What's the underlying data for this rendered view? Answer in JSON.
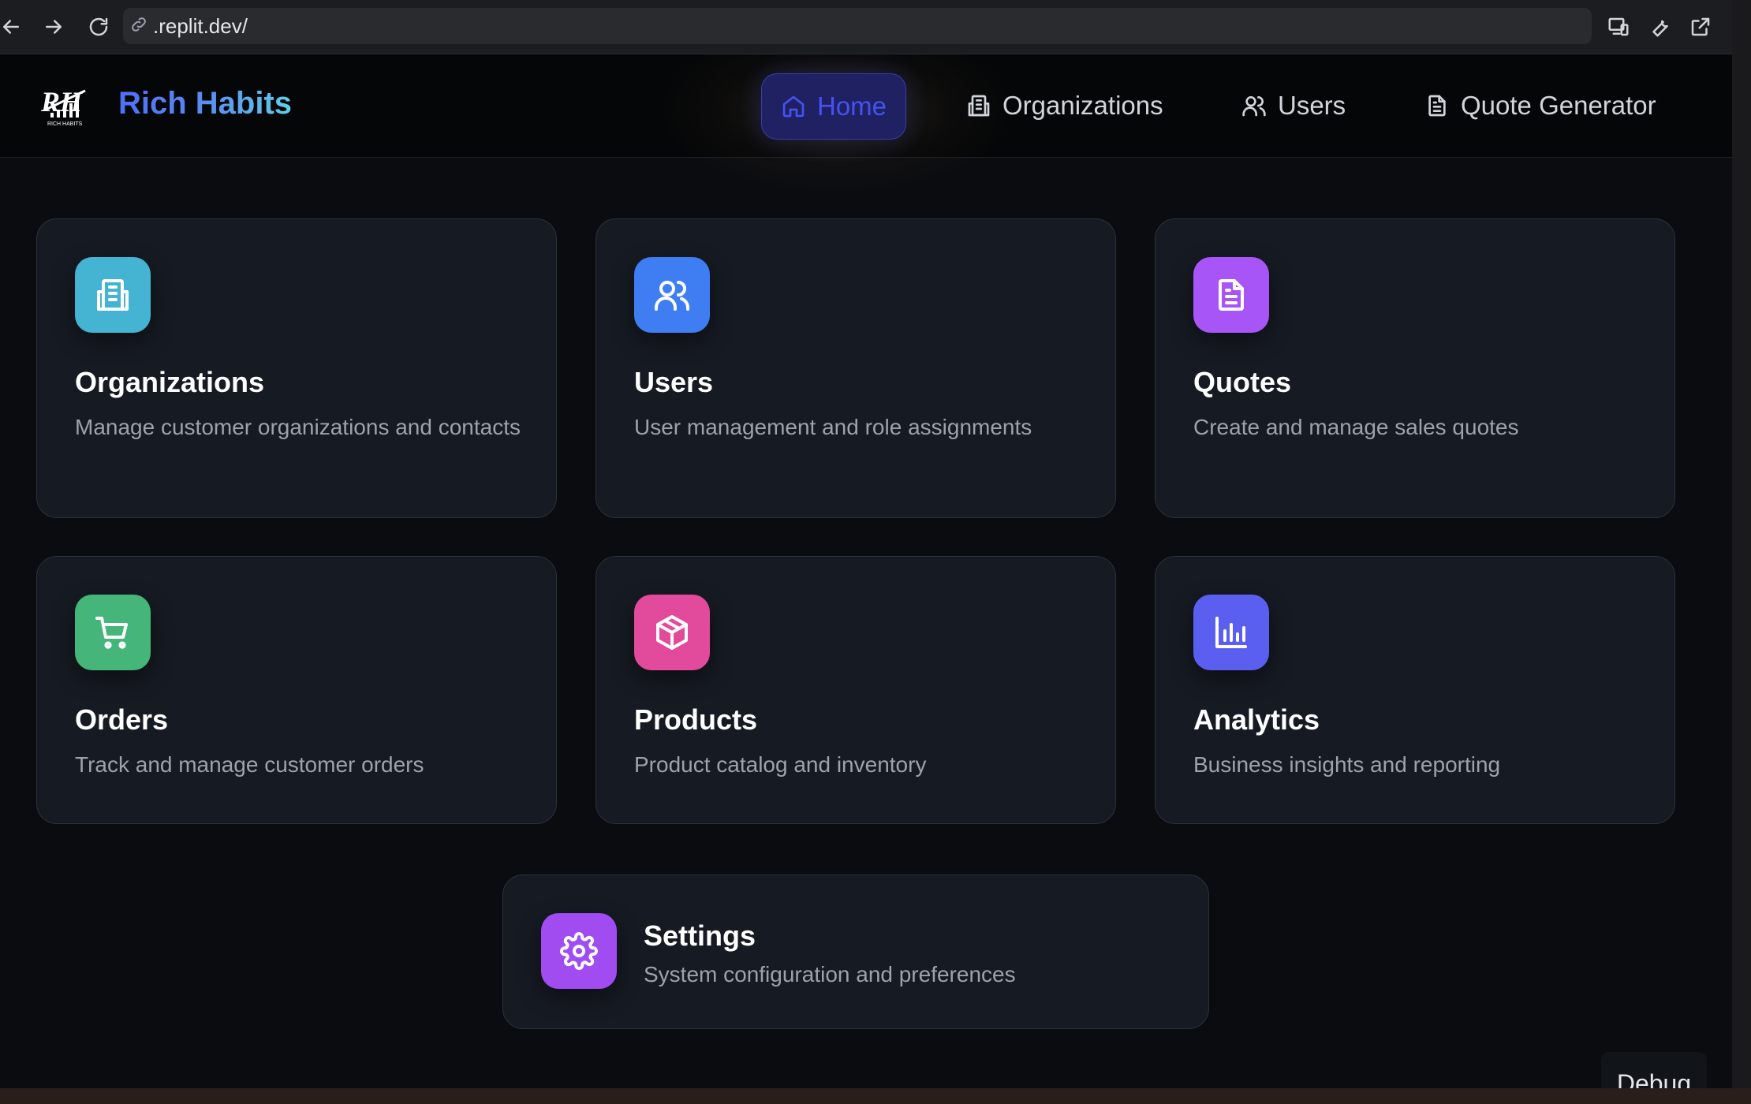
{
  "browser": {
    "url": ".replit.dev/",
    "icons": [
      "back-icon",
      "forward-icon",
      "reload-icon",
      "link-icon",
      "devices-icon",
      "wrench-icon",
      "external-link-icon"
    ]
  },
  "app": {
    "brand": "Rich Habits",
    "nav": [
      {
        "label": "Home",
        "icon": "home-icon",
        "active": true
      },
      {
        "label": "Organizations",
        "icon": "building-icon",
        "active": false
      },
      {
        "label": "Users",
        "icon": "users-icon",
        "active": false
      },
      {
        "label": "Quote Generator",
        "icon": "file-text-icon",
        "active": false
      }
    ],
    "cards": [
      {
        "title": "Organizations",
        "desc": "Manage customer organizations and contacts",
        "icon": "building-icon",
        "color": "#45b3d2"
      },
      {
        "title": "Users",
        "desc": "User management and role assignments",
        "icon": "users-icon",
        "color": "#3f7ef2"
      },
      {
        "title": "Quotes",
        "desc": "Create and manage sales quotes",
        "icon": "file-text-icon",
        "color": "#a855f7"
      },
      {
        "title": "Orders",
        "desc": "Track and manage customer orders",
        "icon": "cart-icon",
        "color": "#46b57a"
      },
      {
        "title": "Products",
        "desc": "Product catalog and inventory",
        "icon": "box-icon",
        "color": "#e24a9b"
      },
      {
        "title": "Analytics",
        "desc": "Business insights and reporting",
        "icon": "bar-chart-icon",
        "color": "#5b5ff0"
      }
    ],
    "settings": {
      "title": "Settings",
      "desc": "System configuration and preferences",
      "icon": "gear-icon",
      "color": "#a04cf0"
    },
    "debug_label": "Debug"
  }
}
